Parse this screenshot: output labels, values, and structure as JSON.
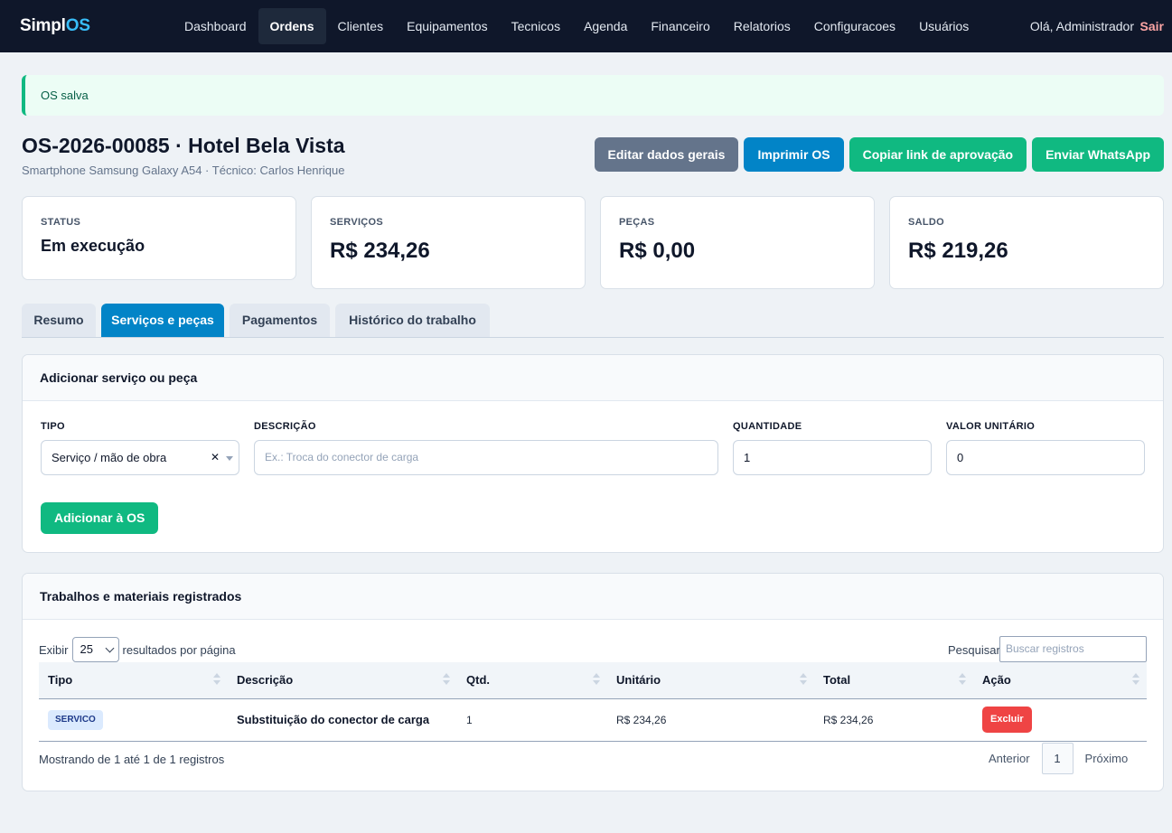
{
  "nav": {
    "brand_main": "Simpl",
    "brand_accent": "OS",
    "items": [
      "Dashboard",
      "Ordens",
      "Clientes",
      "Equipamentos",
      "Tecnicos",
      "Agenda",
      "Financeiro",
      "Relatorios",
      "Configuracoes",
      "Usuários"
    ],
    "active": "Ordens",
    "greeting": "Olá, Administrador",
    "logout": "Sair"
  },
  "alert": "OS salva",
  "header": {
    "title": "OS-2026-00085 · Hotel Bela Vista",
    "subtitle": "Smartphone Samsung Galaxy A54 · Técnico: Carlos Henrique",
    "buttons": {
      "edit": "Editar dados gerais",
      "print": "Imprimir OS",
      "copy": "Copiar link de aprovação",
      "whatsapp": "Enviar WhatsApp"
    }
  },
  "stats": {
    "status": {
      "label": "STATUS",
      "value": "Em execução"
    },
    "services": {
      "label": "SERVIÇOS",
      "value": "R$ 234,26"
    },
    "parts": {
      "label": "PEÇAS",
      "value": "R$ 0,00"
    },
    "balance": {
      "label": "SALDO",
      "value": "R$ 219,26"
    }
  },
  "tabs": {
    "summary": "Resumo",
    "services_parts": "Serviços e peças",
    "payments": "Pagamentos",
    "history": "Histórico do trabalho",
    "active": "Serviços e peças"
  },
  "add_form": {
    "title": "Adicionar serviço ou peça",
    "type_label": "TIPO",
    "type_value": "Serviço / mão de obra",
    "desc_label": "DESCRIÇÃO",
    "desc_placeholder": "Ex.: Troca do conector de carga",
    "qty_label": "QUANTIDADE",
    "qty_value": "1",
    "price_label": "VALOR UNITÁRIO",
    "price_value": "0",
    "submit": "Adicionar à OS"
  },
  "records": {
    "title": "Trabalhos e materiais registrados",
    "show_label": "Exibir",
    "page_size": "25",
    "per_page_label": "resultados por página",
    "search_label": "Pesquisar",
    "search_placeholder": "Buscar registros",
    "columns": {
      "type": "Tipo",
      "description": "Descrição",
      "qty": "Qtd.",
      "unit": "Unitário",
      "total": "Total",
      "action": "Ação"
    },
    "rows": [
      {
        "type": "SERVICO",
        "description": "Substituição do conector de carga",
        "qty": "1",
        "unit": "R$ 234,26",
        "total": "R$ 234,26",
        "action": "Excluir"
      }
    ],
    "info": "Mostrando de 1 até 1 de 1 registros",
    "prev": "Anterior",
    "current_page": "1",
    "next": "Próximo"
  }
}
